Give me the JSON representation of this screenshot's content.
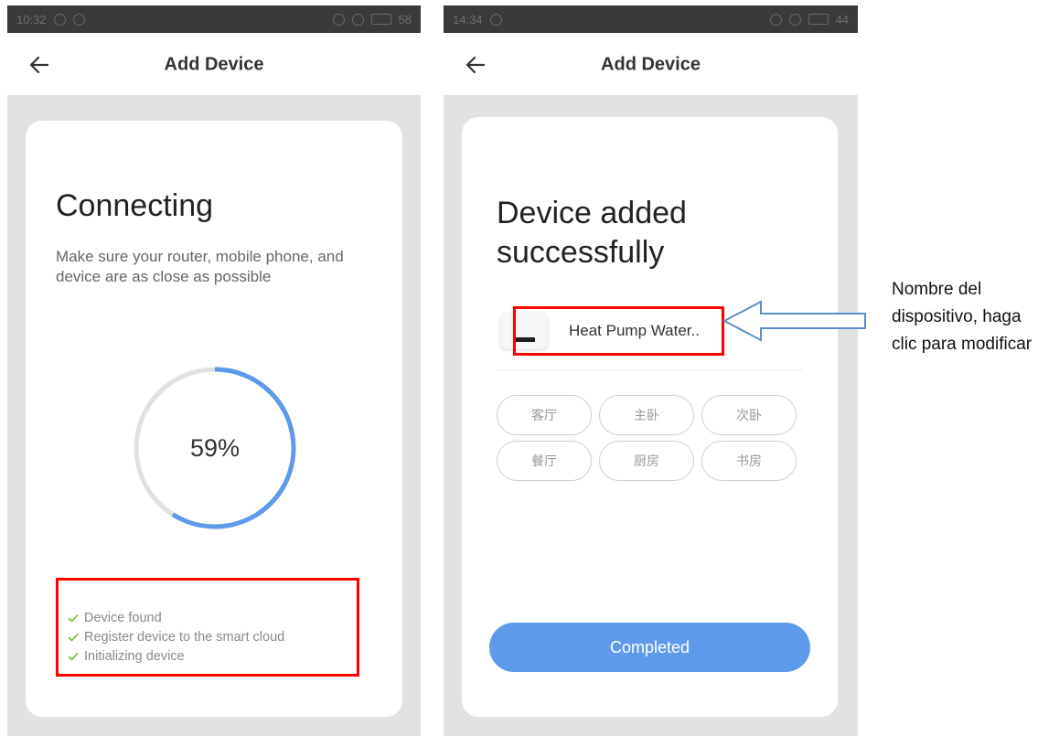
{
  "screens": [
    {
      "status": {
        "time": "10:32",
        "battery": "58"
      },
      "nav": {
        "title": "Add Device"
      },
      "title": "Connecting",
      "description": "Make sure your router, mobile phone, and device are as close as possible",
      "progress": {
        "value": 59,
        "label": "59%"
      },
      "steps": [
        {
          "label": "Device found"
        },
        {
          "label": "Register device to the smart cloud"
        },
        {
          "label": "Initializing device"
        }
      ]
    },
    {
      "status": {
        "time": "14:34",
        "battery": "44"
      },
      "nav": {
        "title": "Add Device"
      },
      "title": "Device added successfully",
      "device": {
        "name": "Heat Pump Water.."
      },
      "rooms": [
        "客厅",
        "主卧",
        "次卧",
        "餐厅",
        "厨房",
        "书房"
      ],
      "button": {
        "label": "Completed"
      }
    }
  ],
  "annotation": {
    "text": "Nombre del dispositivo, haga clic para modificar"
  },
  "colors": {
    "accent": "#5d9bea",
    "ring_track": "#e0e0e0",
    "check": "#7cc242",
    "highlight": "#ff0000",
    "arrow": "#5b8ec9"
  },
  "icons": {
    "back": "arrow-left-icon",
    "check": "check-icon",
    "annotation_arrow": "arrow-left-outline-icon"
  }
}
